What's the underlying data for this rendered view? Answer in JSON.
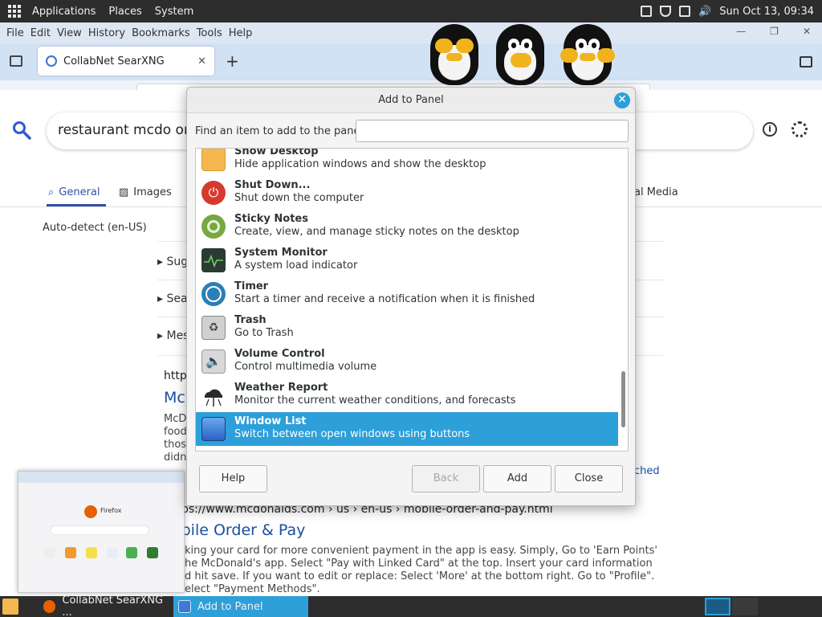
{
  "top_panel": {
    "applications": "Applications",
    "places": "Places",
    "system": "System",
    "clock": "Sun Oct 13, 09:34"
  },
  "browser": {
    "menu": [
      "File",
      "Edit",
      "View",
      "History",
      "Bookmarks",
      "Tools",
      "Help"
    ],
    "tab_title": "CollabNet SearXNG",
    "page": {
      "search_query": "restaurant mcdo ord",
      "tabs": {
        "general": "General",
        "images": "Images",
        "social": "al Media"
      },
      "auto_detect": "Auto-detect (en-US)",
      "expanders": [
        "Sug",
        "Sea",
        "Mes"
      ],
      "result1": {
        "url": "http",
        "title": "Mc",
        "text": [
          "McD",
          "food",
          "thos",
          "didn"
        ],
        "cached": "ched"
      },
      "result2": {
        "url": "ps://www.mcdonalds.com  › us › en-us › mobile-order-and-pay.html",
        "title": "obile Order & Pay",
        "text": [
          "king your card for more convenient payment in the app is easy. Simply, Go to 'Earn Points'",
          "he McDonald's app. Select \"Pay with Linked Card\" at the top. Insert your card information",
          "d hit save. If you want to edit or replace: Select 'More' at the bottom right. Go to \"Profile\".",
          "elect \"Payment Methods\"."
        ]
      }
    },
    "preview": {
      "brand": "Firefox"
    }
  },
  "dialog": {
    "title": "Add to Panel",
    "find_label": "Find an item to add to the panel:",
    "find_value": "",
    "items": [
      {
        "name": "Show Desktop",
        "desc": "Hide application windows and show the desktop",
        "icon": "show-desktop-icon",
        "color": "#f5b74f"
      },
      {
        "name": "Shut Down...",
        "desc": "Shut down the computer",
        "icon": "power-icon",
        "color": "#d63a2f"
      },
      {
        "name": "Sticky Notes",
        "desc": "Create, view, and manage sticky notes on the desktop",
        "icon": "sticky-notes-icon",
        "color": "#78a842"
      },
      {
        "name": "System Monitor",
        "desc": "A system load indicator",
        "icon": "system-monitor-icon",
        "color": "#2b3a32"
      },
      {
        "name": "Timer",
        "desc": "Start a timer and receive a notification when it is finished",
        "icon": "timer-icon",
        "color": "#2a7fb8"
      },
      {
        "name": "Trash",
        "desc": "Go to Trash",
        "icon": "trash-icon",
        "color": "#6e6e6e"
      },
      {
        "name": "Volume Control",
        "desc": "Control multimedia volume",
        "icon": "volume-icon",
        "color": "#d8d8d8"
      },
      {
        "name": "Weather Report",
        "desc": "Monitor the current weather conditions, and forecasts",
        "icon": "weather-icon",
        "color": "#3a3a3a"
      },
      {
        "name": "Window List",
        "desc": "Switch between open windows using buttons",
        "icon": "window-list-icon",
        "color": "#3a7ad8"
      }
    ],
    "selected_item": "Window List",
    "buttons": {
      "help": "Help",
      "back": "Back",
      "add": "Add",
      "close": "Close"
    },
    "accent": "#2d9fd9"
  },
  "taskbar": {
    "items": [
      {
        "label": "CollabNet SearXNG ...",
        "active": false
      },
      {
        "label": "Add to Panel",
        "active": true
      }
    ]
  }
}
